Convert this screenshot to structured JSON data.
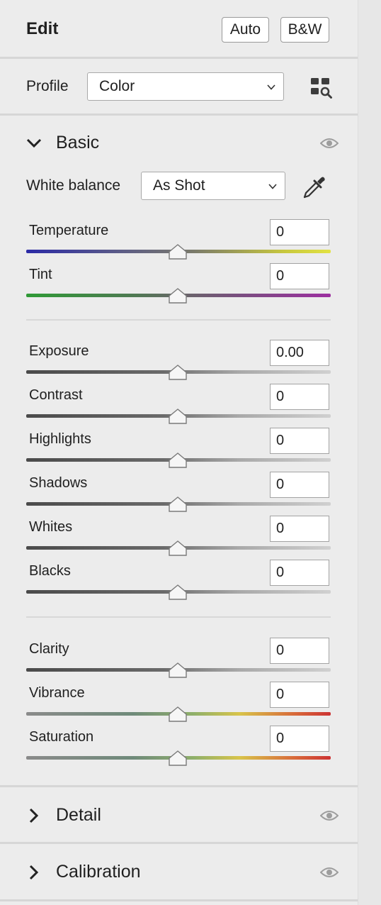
{
  "header": {
    "title": "Edit",
    "auto_label": "Auto",
    "bw_label": "B&W"
  },
  "profile": {
    "label": "Profile",
    "value": "Color"
  },
  "basic": {
    "title": "Basic",
    "white_balance": {
      "label": "White balance",
      "value": "As Shot"
    },
    "sliders": [
      {
        "label": "Temperature",
        "value": "0"
      },
      {
        "label": "Tint",
        "value": "0"
      },
      {
        "label": "Exposure",
        "value": "0.00"
      },
      {
        "label": "Contrast",
        "value": "0"
      },
      {
        "label": "Highlights",
        "value": "0"
      },
      {
        "label": "Shadows",
        "value": "0"
      },
      {
        "label": "Whites",
        "value": "0"
      },
      {
        "label": "Blacks",
        "value": "0"
      },
      {
        "label": "Clarity",
        "value": "0"
      },
      {
        "label": "Vibrance",
        "value": "0"
      },
      {
        "label": "Saturation",
        "value": "0"
      }
    ]
  },
  "sections": {
    "detail": "Detail",
    "calibration": "Calibration"
  },
  "icons": {
    "eye": "eye-icon",
    "eyedropper": "eyedropper-icon",
    "profile_browser": "profile-browser-icon",
    "chevron": "chevron-down-icon"
  },
  "colors": {
    "panel_bg": "#ececec",
    "separator": "#d6d6d6",
    "text": "#1f1f1f"
  }
}
